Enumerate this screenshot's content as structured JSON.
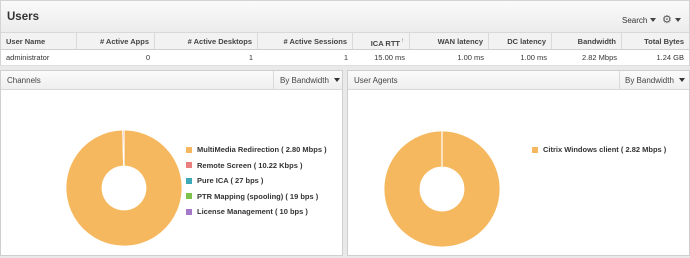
{
  "users": {
    "title": "Users",
    "search_label": "Search",
    "gear_glyph": "⚙",
    "columns": [
      "User Name",
      "# Active Apps",
      "# Active Desktops",
      "# Active Sessions",
      "ICA RTT",
      "WAN latency",
      "DC latency",
      "Bandwidth",
      "Total Bytes"
    ],
    "sort_indicator": "↑",
    "rows": [
      [
        "administrator",
        "0",
        "1",
        "1",
        "15.00 ms",
        "1.00 ms",
        "1.00 ms",
        "2.82 Mbps",
        "1.24 GB"
      ]
    ]
  },
  "channels": {
    "title": "Channels",
    "sort_label": "By Bandwidth",
    "legend": [
      {
        "label": "MultiMedia Redirection ( 2.80 Mbps )",
        "color": "#f6b85e"
      },
      {
        "label": "Remote Screen ( 10.22 Kbps )",
        "color": "#ea7f7f"
      },
      {
        "label": "Pure ICA ( 27 bps )",
        "color": "#3fa9b8"
      },
      {
        "label": "PTR Mapping (spooling) ( 19 bps )",
        "color": "#7dc24b"
      },
      {
        "label": "License Management ( 10 bps )",
        "color": "#a678c9"
      }
    ]
  },
  "user_agents": {
    "title": "User Agents",
    "sort_label": "By Bandwidth",
    "legend": [
      {
        "label": "Citrix Windows client ( 2.82 Mbps )",
        "color": "#f6b85e"
      }
    ]
  },
  "chart_data": [
    {
      "type": "pie",
      "title": "Channels",
      "unit": "bps",
      "categories": [
        "MultiMedia Redirection",
        "Remote Screen",
        "Pure ICA",
        "PTR Mapping (spooling)",
        "License Management"
      ],
      "values": [
        2800000,
        10220,
        27,
        19,
        10
      ],
      "colors": [
        "#f6b85e",
        "#ea7f7f",
        "#3fa9b8",
        "#7dc24b",
        "#a678c9"
      ]
    },
    {
      "type": "pie",
      "title": "User Agents",
      "unit": "bps",
      "categories": [
        "Citrix Windows client"
      ],
      "values": [
        2820000
      ],
      "colors": [
        "#f6b85e"
      ]
    }
  ]
}
